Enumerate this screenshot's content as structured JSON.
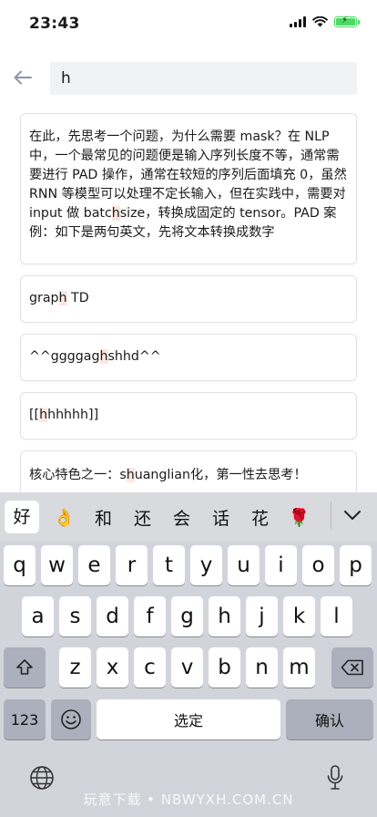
{
  "status_bar": {
    "time": "23:43"
  },
  "header": {
    "search_value": "h"
  },
  "cards": [
    {
      "text": "在此，先思考一个问题，为什么需要 mask？在 NLP 中，一个最常见的问题便是输入序列长度不等，通常需要进行 PAD 操作，通常在较短的序列后面填充 0，虽然 RNN 等模型可以处理不定长输入，但在实践中，需要对 input 做 batchsize，转换成固定的 tensor。PAD 案例：如下是两句英文，先将文本转换成数字"
    },
    {
      "text": "graph TD"
    },
    {
      "text": "^^ggggaghshhd^^"
    },
    {
      "text": "[[hhhhhh]]"
    },
    {
      "text": "核心特色之一：shuanglian化，第一性去思考！"
    }
  ],
  "keyboard": {
    "candidates": [
      "好",
      "👌",
      "和",
      "还",
      "会",
      "话",
      "花",
      "🌹"
    ],
    "row1": [
      "q",
      "w",
      "e",
      "r",
      "t",
      "y",
      "u",
      "i",
      "o",
      "p"
    ],
    "row2": [
      "a",
      "s",
      "d",
      "f",
      "g",
      "h",
      "j",
      "k",
      "l"
    ],
    "row3": [
      "z",
      "x",
      "c",
      "v",
      "b",
      "n",
      "m"
    ],
    "numbers_label": "123",
    "space_label": "选定",
    "confirm_label": "确认"
  },
  "watermark": "玩意下载 • NBWYXH.COM.CN",
  "colors": {
    "battery": "#4cd964",
    "highlight": "#fbe7df",
    "keyboard_bg": "#d2d4db"
  }
}
